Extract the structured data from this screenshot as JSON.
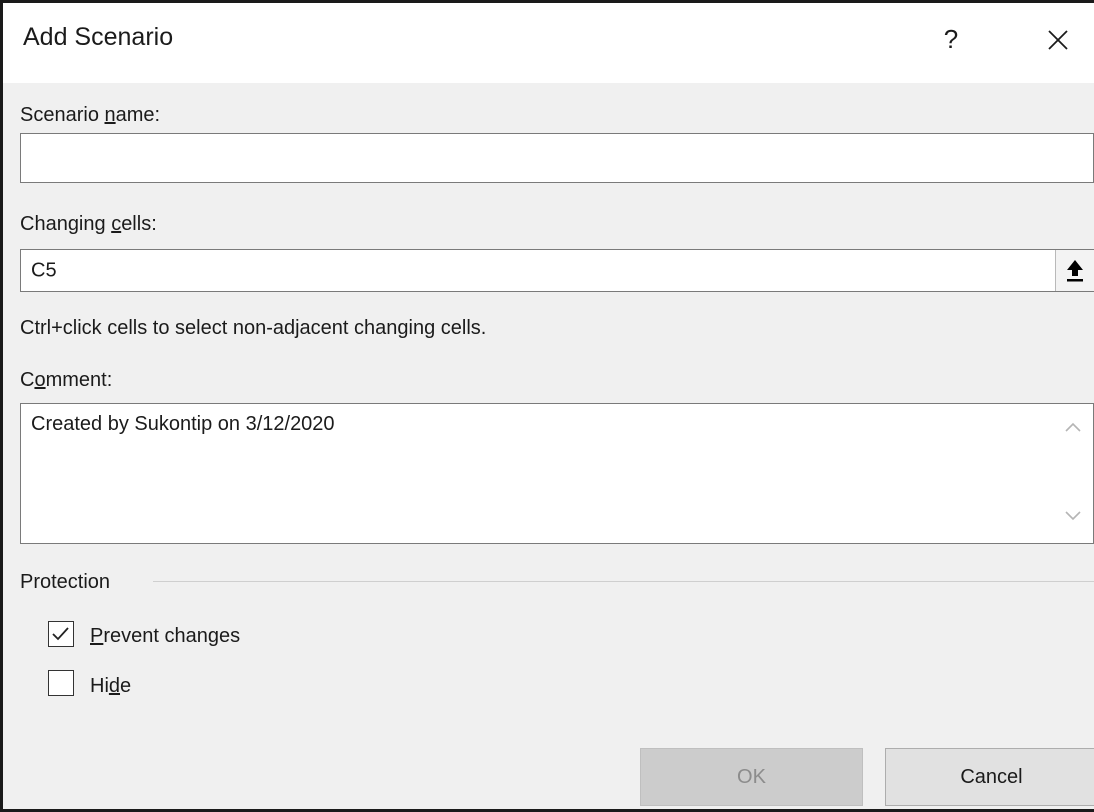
{
  "dialog": {
    "title": "Add Scenario",
    "help_label": "?",
    "close_icon": "close-icon"
  },
  "scenario_name": {
    "label_before": "Scenario ",
    "label_accel": "n",
    "label_after": "ame:",
    "value": ""
  },
  "changing_cells": {
    "label_before": "Changing ",
    "label_accel": "c",
    "label_after": "ells:",
    "value": "C5",
    "collapse_icon": "collapse-dialog-icon",
    "hint": "Ctrl+click cells to select non-adjacent changing cells."
  },
  "comment": {
    "label_before": "C",
    "label_accel": "o",
    "label_after": "mment:",
    "value": "Created by Sukontip on 3/12/2020",
    "scroll_up_icon": "chevron-up-icon",
    "scroll_down_icon": "chevron-down-icon"
  },
  "protection": {
    "group_label": "Protection",
    "prevent_changes": {
      "label_accel": "P",
      "label_after": "revent changes",
      "checked": true
    },
    "hide": {
      "label_before": "Hi",
      "label_accel": "d",
      "label_after": "e",
      "checked": false
    }
  },
  "buttons": {
    "ok_label": "OK",
    "ok_enabled": false,
    "cancel_label": "Cancel"
  }
}
